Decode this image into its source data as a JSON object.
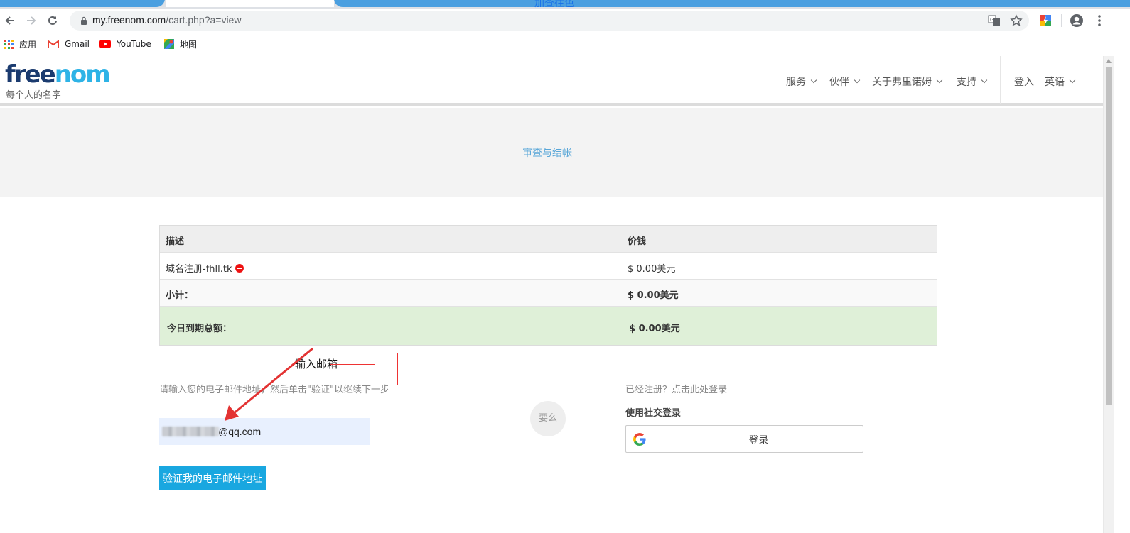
{
  "browser": {
    "tab_partial_title": "加查往色",
    "url_host": "my.freenom.com",
    "url_path": "/cart.php?a=view",
    "bookmarks": [
      {
        "label": "应用"
      },
      {
        "label": "Gmail"
      },
      {
        "label": "YouTube"
      },
      {
        "label": "地图"
      }
    ]
  },
  "site": {
    "logo_part1": "free",
    "logo_part2": "nom",
    "tagline": "每个人的名字",
    "nav": {
      "services": "服务",
      "partners": "伙伴",
      "about": "关于弗里诺姆",
      "support": "支持",
      "login": "登入",
      "language": "英语"
    },
    "banner_title": "审查与结帐"
  },
  "cart": {
    "headers": {
      "description": "描述",
      "price": "价钱"
    },
    "item": {
      "description": "域名注册-fhll.tk",
      "price": "$ 0.00美元"
    },
    "subtotal": {
      "label": "小计：",
      "price": "$ 0.00美元"
    },
    "total": {
      "label": "今日到期总额：",
      "price": "$ 0.00美元"
    }
  },
  "annotation": {
    "label": "输入邮箱"
  },
  "email_section": {
    "prompt": "请输入您的电子邮件地址，然后单击\"验证\"以继续下一步",
    "email_value": "@qq.com",
    "verify_button": "验证我的电子邮件地址"
  },
  "or_label": "要么",
  "social_section": {
    "prompt": "已经注册？点击此处登录",
    "title": "使用社交登录",
    "google_button": "登录"
  },
  "colors": {
    "brand_dark": "#1b3b6f",
    "brand_light": "#2eb3e6",
    "accent_button": "#19a7e0",
    "total_row": "#dff0d8",
    "annotation": "#e33333"
  }
}
